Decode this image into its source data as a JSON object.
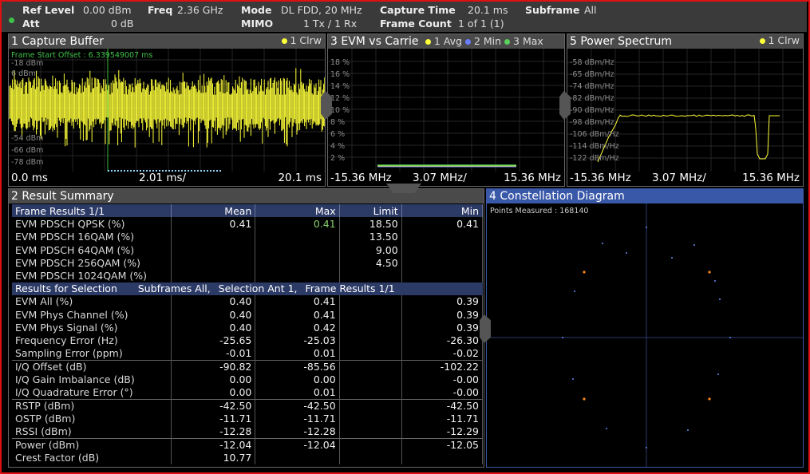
{
  "header": {
    "ref_level_label": "Ref Level",
    "ref_level_value": "0.00 dBm",
    "att_label": "Att",
    "att_value": "0 dB",
    "freq_label": "Freq",
    "freq_value": "2.36 GHz",
    "mode_label": "Mode",
    "mode_value": "DL FDD, 20 MHz",
    "mimo_label": "MIMO",
    "mimo_value": "1 Tx / 1 Rx",
    "capture_time_label": "Capture Time",
    "capture_time_value": "20.1 ms",
    "frame_count_label": "Frame Count",
    "frame_count_value": "1 of 1 (1)",
    "subframe_label": "Subframe",
    "subframe_value": "All"
  },
  "colors": {
    "trace_yellow": "#ffff3a",
    "trace_blue": "#6a7cff",
    "trace_green": "#5ad05a",
    "constellation_orange": "#ff8a1e",
    "frame_red": "#d11111"
  },
  "capture_buffer": {
    "title": "1 Capture Buffer",
    "trace_tag": "1 Clrw",
    "offset_text": "Frame Start Offset : 6.339549007 ms",
    "y_labels": [
      "-18 dBm",
      "6 dBm",
      "-54 dBm",
      "-66 dBm",
      "-78 dBm"
    ],
    "axis_start": "0.0  ms",
    "axis_div": "2.01 ms/",
    "axis_end": "20.1 ms"
  },
  "evm_carrier": {
    "title": "3 EVM vs Carrie",
    "legend_1": "1 Avg",
    "legend_2": "2 Min",
    "legend_3": "3 Max",
    "y_labels": [
      "18 %",
      "16 %",
      "14 %",
      "12 %",
      "10 %",
      "8 %",
      "6 %",
      "4 %",
      "2 %"
    ],
    "axis_start": "-15.36 MHz",
    "axis_div": "3.07 MHz/",
    "axis_end": "15.36 MHz"
  },
  "power_spectrum": {
    "title": "5 Power Spectrum",
    "trace_tag": "1 Clrw",
    "y_labels": [
      "-58 dBm/Hz",
      "-65 dBm/Hz",
      "-74 dBm/Hz",
      "-82 dBm/Hz",
      "-90 dBm/Hz",
      "-98 dBm/Hz",
      "-106 dBm/Hz",
      "-114 dBm/Hz",
      "-122 dBm/Hz"
    ],
    "axis_start": "-15.36 MHz",
    "axis_div": "3.07 MHz/",
    "axis_end": "15.36 MHz"
  },
  "result_summary": {
    "title": "2 Result Summary",
    "frame_header": [
      "Frame Results 1/1",
      "Mean",
      "Max",
      "Limit",
      "Min"
    ],
    "frame_rows": [
      [
        "EVM PDSCH QPSK (%)",
        "0.41",
        "0.41",
        "18.50",
        "0.41"
      ],
      [
        "EVM PDSCH 16QAM (%)",
        "",
        "",
        "13.50",
        ""
      ],
      [
        "EVM PDSCH 64QAM (%)",
        "",
        "",
        "9.00",
        ""
      ],
      [
        "EVM PDSCH 256QAM (%)",
        "",
        "",
        "4.50",
        ""
      ],
      [
        "EVM PDSCH 1024QAM (%)",
        "",
        "",
        "",
        ""
      ]
    ],
    "selection_label": "Results for Selection",
    "selection_subframes": "Subframes  All,",
    "selection_selection": "Selection  Ant 1,",
    "selection_frame": "Frame Results  1/1",
    "selection_rows": [
      [
        "EVM All (%)",
        "0.40",
        "0.41",
        "0.39"
      ],
      [
        "EVM Phys Channel (%)",
        "0.40",
        "0.41",
        "0.39"
      ],
      [
        "EVM Phys Signal (%)",
        "0.40",
        "0.42",
        "0.39"
      ],
      [
        "Frequency Error (Hz)",
        "-25.65",
        "-25.03",
        "-26.30"
      ],
      [
        "Sampling Error (ppm)",
        "-0.01",
        "0.01",
        "-0.02"
      ],
      [
        "I/Q Offset (dB)",
        "-90.82",
        "-85.56",
        "-102.22"
      ],
      [
        "I/Q Gain Imbalance (dB)",
        "0.00",
        "0.00",
        "-0.00"
      ],
      [
        "I/Q Quadrature Error (°)",
        "0.00",
        "0.01",
        "-0.00"
      ],
      [
        "RSTP (dBm)",
        "-42.50",
        "-42.50",
        "-42.50"
      ],
      [
        "OSTP (dBm)",
        "-11.71",
        "-11.71",
        "-11.71"
      ],
      [
        "RSSI (dBm)",
        "-12.28",
        "-12.28",
        "-12.29"
      ],
      [
        "Power (dBm)",
        "-12.04",
        "-12.04",
        "-12.05"
      ],
      [
        "Crest Factor (dB)",
        "10.77",
        "",
        ""
      ]
    ]
  },
  "constellation": {
    "title": "4 Constellation Diagram",
    "points_text": "Points Measured : 168140"
  }
}
